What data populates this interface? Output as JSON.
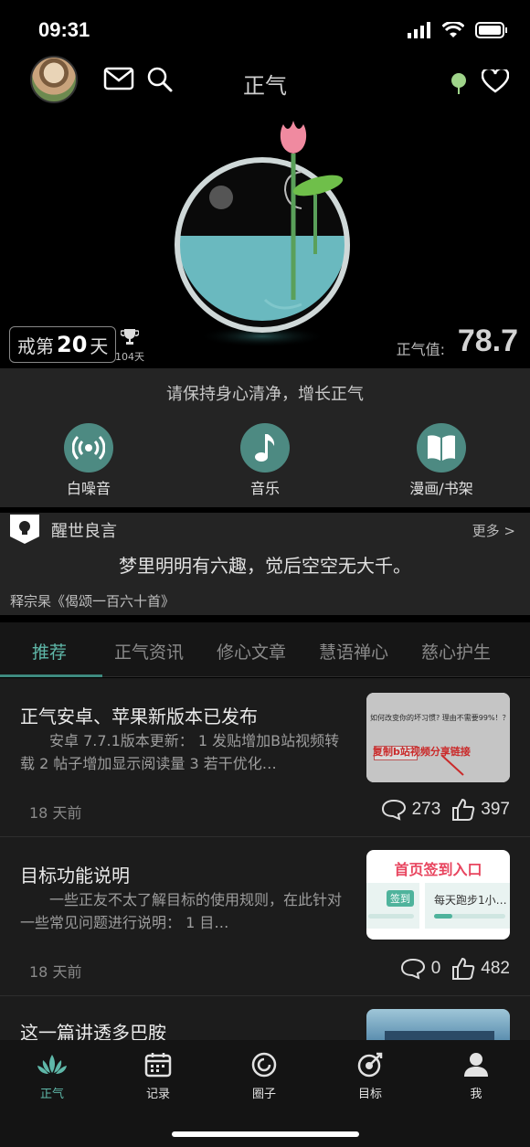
{
  "status": {
    "time": "09:31"
  },
  "header": {
    "title": "正气"
  },
  "hero": {
    "streak_prefix": "戒第",
    "streak_days": "20",
    "streak_suffix": "天",
    "best_days": "104天",
    "zq_label": "正气值:",
    "zq_value": "78.7"
  },
  "tools": {
    "motto": "请保持身心清净，增长正气",
    "items": [
      {
        "label": "白噪音",
        "icon": "broadcast-icon"
      },
      {
        "label": "音乐",
        "icon": "music-note-icon"
      },
      {
        "label": "漫画/书架",
        "icon": "book-icon"
      }
    ]
  },
  "quote": {
    "title": "醒世良言",
    "more": "更多 >",
    "text": "梦里明明有六趣，觉后空空无大千。",
    "source": "释宗杲《偈颂一百六十首》"
  },
  "tabs": [
    "推荐",
    "正气资讯",
    "修心文章",
    "慧语禅心",
    "慈心护生"
  ],
  "posts": [
    {
      "title": "正气安卓、苹果新版本已发布",
      "desc": "安卓 7.7.1版本更新： 1 发贴增加B站视频转载 2 帖子增加显示阅读量 3 若干优化…",
      "time": "18 天前",
      "comments": "273",
      "likes": "397",
      "thumb": {
        "line1": "如何改变你的坏习惯? 理由不需要99%！？",
        "line2": "复制b站视频分享链接"
      }
    },
    {
      "title": "目标功能说明",
      "desc": "一些正友不太了解目标的使用规则，在此针对一些常见问题进行说明： 1 目…",
      "time": "18 天前",
      "comments": "0",
      "likes": "482",
      "thumb": {
        "heading": "首页签到入口",
        "chip": "签到",
        "task": "每天跑步1小…"
      }
    },
    {
      "title": "这一篇讲透多巴胺"
    }
  ],
  "nav": [
    {
      "label": "正气",
      "icon": "lotus-icon",
      "active": true
    },
    {
      "label": "记录",
      "icon": "calendar-icon",
      "active": false
    },
    {
      "label": "圈子",
      "icon": "circle-icon",
      "active": false
    },
    {
      "label": "目标",
      "icon": "target-icon",
      "active": false
    },
    {
      "label": "我",
      "icon": "person-icon",
      "active": false
    }
  ],
  "colors": {
    "accent": "#5fb8a9",
    "teal_button": "#4d8a82",
    "lotus": "#f08aa0",
    "water": "#6ab9bf"
  }
}
